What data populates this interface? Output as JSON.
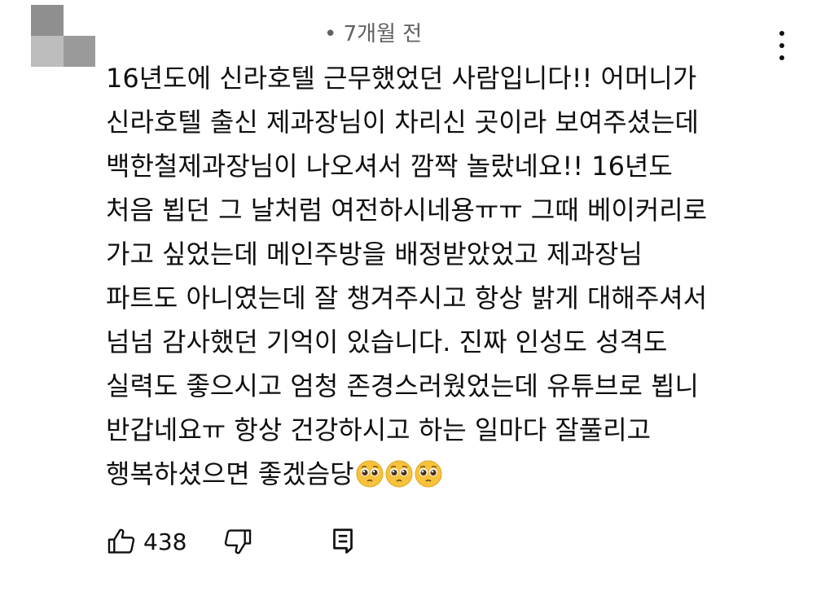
{
  "comment": {
    "time_ago": "• 7개월 전",
    "lines": [
      "16년도에 신라호텔 근무했었던 사람입니다!! 어머니가",
      "신라호텔 출신 제과장님이 차리신 곳이라 보여주셨는데",
      "백한철제과장님이 나오셔서 깜짝 놀랐네요!! 16년도",
      "처음 뵙던 그 날처럼 여전하시네용ㅠㅠ 그때 베이커리로",
      "가고 싶었는데 메인주방을 배정받았었고 제과장님",
      "파트도 아니였는데 잘 챙겨주시고 항상 밝게 대해주셔서",
      "넘넘 감사했던 기억이 있습니다. 진짜 인성도 성격도",
      "실력도 좋으시고 엄청 존경스러웠었는데 유튜브로 뵙니",
      "반갑네요ㅠ 항상 건강하시고 하는 일마다 잘풀리고",
      "행복하셨으면 좋겠슴당"
    ],
    "emojis": [
      "pleading-face",
      "pleading-face",
      "pleading-face"
    ],
    "like_count": "438"
  },
  "icons": {
    "like": "thumbs-up-icon",
    "dislike": "thumbs-down-icon",
    "reply": "reply-comment-icon",
    "more": "more-vertical-icon"
  },
  "colors": {
    "text": "#0f0f0f",
    "secondary": "#606060",
    "emoji": "#f7c23c"
  }
}
